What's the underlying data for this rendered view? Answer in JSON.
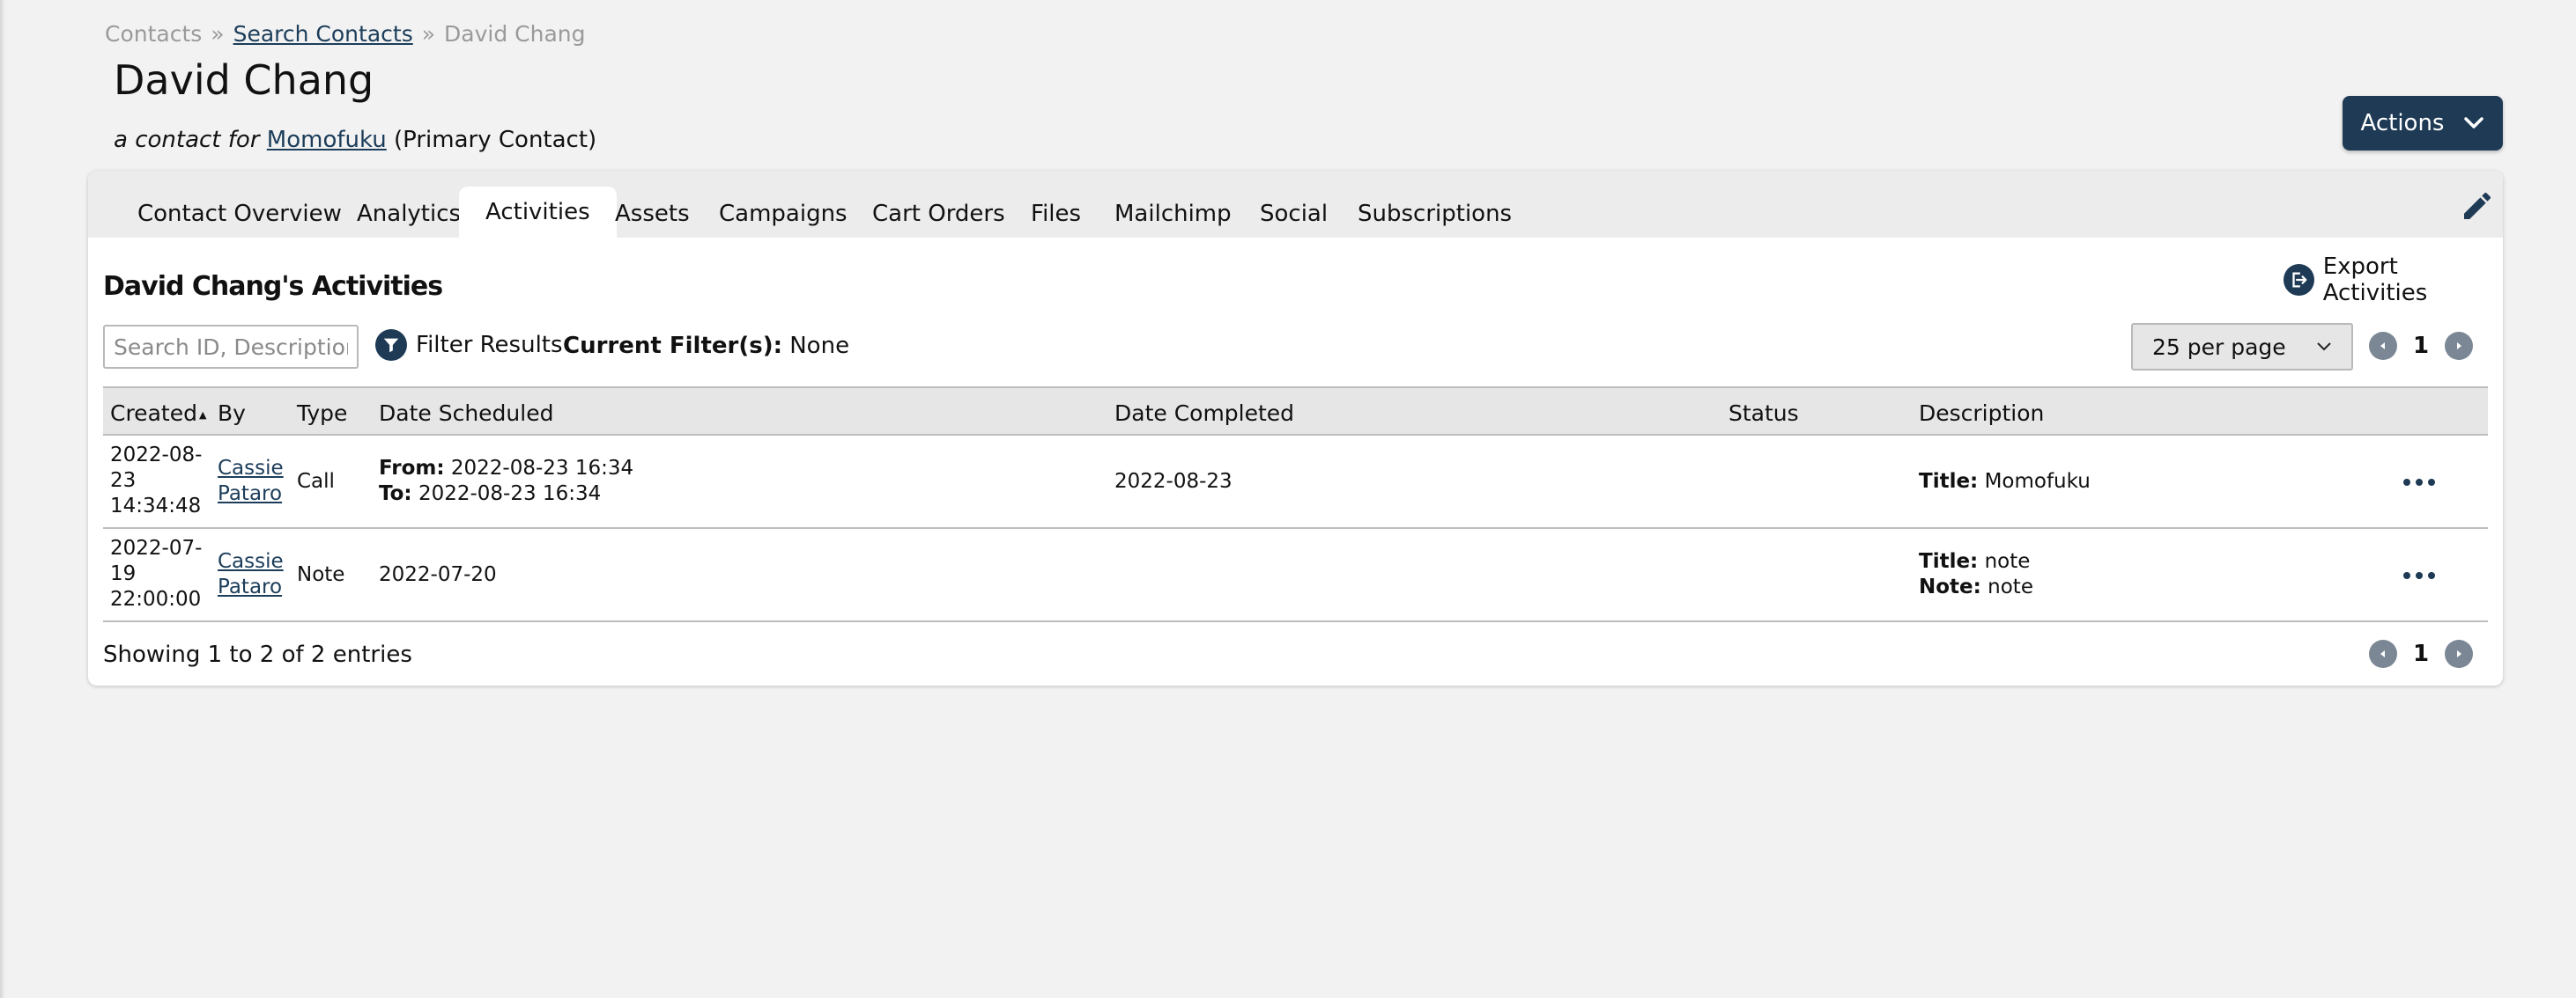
{
  "breadcrumb": {
    "root": "Contacts",
    "sep1": "»",
    "search": "Search Contacts",
    "sep2": "»",
    "current": "David Chang"
  },
  "page": {
    "title": "David Chang",
    "subtitle_prefix": "a contact for",
    "company": "Momofuku",
    "subtitle_suffix": "(Primary Contact)"
  },
  "actions": {
    "label": "Actions"
  },
  "tabs": [
    {
      "label": "Contact Overview"
    },
    {
      "label": "Analytics"
    },
    {
      "label": "Activities"
    },
    {
      "label": "Assets"
    },
    {
      "label": "Campaigns"
    },
    {
      "label": "Cart Orders"
    },
    {
      "label": "Files"
    },
    {
      "label": "Mailchimp"
    },
    {
      "label": "Social"
    },
    {
      "label": "Subscriptions"
    }
  ],
  "activeTab": "Activities",
  "section": {
    "title": "David Chang's Activities",
    "export_label": "Export Activities",
    "search_placeholder": "Search ID, Description",
    "filter_label": "Filter Results",
    "current_filter_label": "Current Filter(s):",
    "current_filter_value": "None",
    "per_page": "25 per page",
    "page": "1"
  },
  "table": {
    "headers": [
      "Created",
      "By",
      "Type",
      "Date Scheduled",
      "Date Completed",
      "Status",
      "Description"
    ],
    "sort_indicator": "▲",
    "rows": [
      {
        "created": [
          "2022-08-",
          "23",
          "14:34:48"
        ],
        "by": [
          "Cassie",
          "Pataro"
        ],
        "type": "Call",
        "scheduled_from_label": "From:",
        "scheduled_from": "2022-08-23 16:34",
        "scheduled_to_label": "To:",
        "scheduled_to": "2022-08-23 16:34",
        "completed": "2022-08-23",
        "status": "",
        "desc_title_label": "Title:",
        "desc_title": "Momofuku"
      },
      {
        "created": [
          "2022-07-",
          "19",
          "22:00:00"
        ],
        "by": [
          "Cassie",
          "Pataro"
        ],
        "type": "Note",
        "scheduled": "2022-07-20",
        "completed": "",
        "status": "",
        "desc_title_label": "Title:",
        "desc_title": "note",
        "desc_note_label": "Note:",
        "desc_note": "note"
      }
    ]
  },
  "footer": {
    "showing": "Showing 1 to 2 of 2 entries",
    "page": "1"
  },
  "colors": {
    "primary": "#1e3a55",
    "pager": "#7b8794",
    "background": "#f2f2f2"
  }
}
